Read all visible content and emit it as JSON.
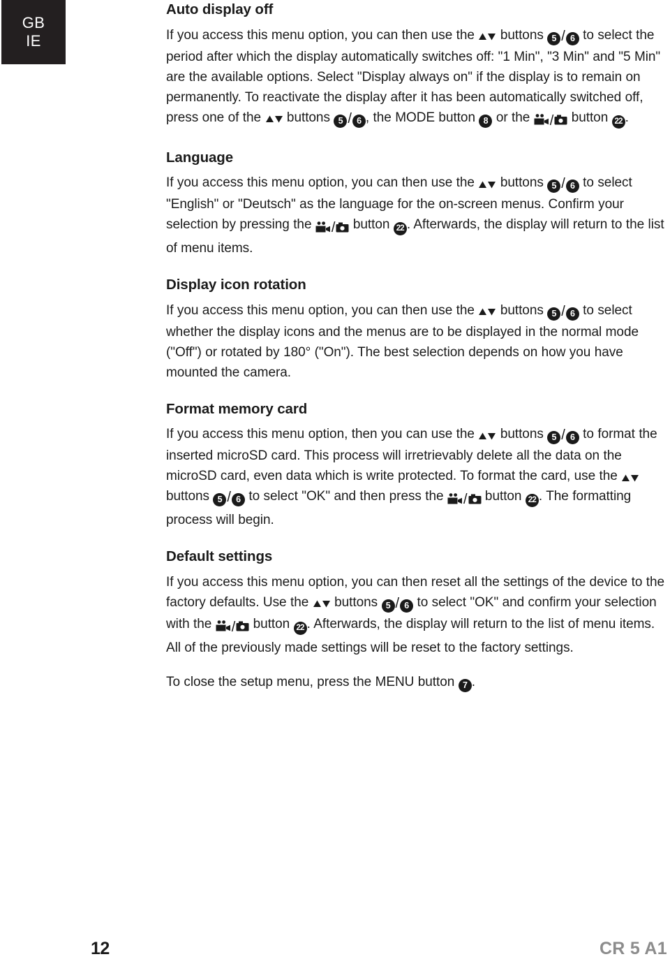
{
  "page": {
    "country_badge": {
      "line1": "GB",
      "line2": "IE"
    },
    "footer": {
      "page_number": "12",
      "document_code": "CR 5 A1"
    },
    "colors": {
      "badge_background": "#231f20",
      "badge_text": "#ffffff",
      "body_text": "#1a1a1a",
      "doc_code_gray": "#8c8c8c",
      "icon_black": "#1a1a1a"
    }
  },
  "sections": [
    {
      "id": "auto-display-off",
      "heading": "Auto display off",
      "paragraphs": [
        {
          "runs": [
            {
              "type": "text",
              "value": "If you access this menu option, you can then use the "
            },
            {
              "type": "arrows",
              "value": "▲▼"
            },
            {
              "type": "text",
              "value": " buttons "
            },
            {
              "type": "badge",
              "value": "5"
            },
            {
              "type": "slash",
              "value": "/"
            },
            {
              "type": "badge",
              "value": "6"
            },
            {
              "type": "text",
              "value": " to select the period after which the display automatically switches off: \"1 Min\", \"3 Min\" and \"5 Min\" are the available options. Select \"Display always on\" if the display is to remain on permanently. To reactivate the display after it has been automatically switched off, press one of the "
            },
            {
              "type": "arrows",
              "value": "▲▼"
            },
            {
              "type": "text",
              "value": " buttons "
            },
            {
              "type": "badge",
              "value": "5"
            },
            {
              "type": "slash",
              "value": "/"
            },
            {
              "type": "badge",
              "value": "6"
            },
            {
              "type": "text",
              "value": ", the MODE button "
            },
            {
              "type": "badge",
              "value": "8"
            },
            {
              "type": "text",
              "value": " or the "
            },
            {
              "type": "camera-pair",
              "value": "video/photo"
            },
            {
              "type": "text",
              "value": " button "
            },
            {
              "type": "badge",
              "value": "22"
            },
            {
              "type": "text",
              "value": "."
            }
          ]
        }
      ]
    },
    {
      "id": "language",
      "heading": "Language",
      "paragraphs": [
        {
          "runs": [
            {
              "type": "text",
              "value": "If you access this menu option, you can then use the "
            },
            {
              "type": "arrows",
              "value": "▲▼"
            },
            {
              "type": "text",
              "value": " buttons "
            },
            {
              "type": "badge",
              "value": "5"
            },
            {
              "type": "slash",
              "value": "/"
            },
            {
              "type": "badge",
              "value": "6"
            },
            {
              "type": "text",
              "value": " to select \"English\" or \"Deutsch\" as the language for the on-screen menus. Confirm your selection by pressing the "
            },
            {
              "type": "camera-pair",
              "value": "video/photo"
            },
            {
              "type": "text",
              "value": " button "
            },
            {
              "type": "badge",
              "value": "22"
            },
            {
              "type": "text",
              "value": ". Afterwards, the display will return to the list of menu items."
            }
          ]
        }
      ]
    },
    {
      "id": "display-icon-rotation",
      "heading": "Display icon rotation",
      "paragraphs": [
        {
          "runs": [
            {
              "type": "text",
              "value": "If you access this menu option, you can then use the "
            },
            {
              "type": "arrows",
              "value": "▲▼"
            },
            {
              "type": "text",
              "value": " buttons "
            },
            {
              "type": "badge",
              "value": "5"
            },
            {
              "type": "slash",
              "value": "/"
            },
            {
              "type": "badge",
              "value": "6"
            },
            {
              "type": "text",
              "value": " to select whether the display icons and the menus are to be displayed in the normal mode (\"Off\") or rotated by 180° (\"On\"). The best selection depends on how you have mounted the camera."
            }
          ]
        }
      ]
    },
    {
      "id": "format-memory-card",
      "heading": "Format memory card",
      "paragraphs": [
        {
          "runs": [
            {
              "type": "text",
              "value": "If you access this menu option, then you can use the "
            },
            {
              "type": "arrows",
              "value": "▲▼"
            },
            {
              "type": "text",
              "value": " buttons "
            },
            {
              "type": "badge",
              "value": "5"
            },
            {
              "type": "slash",
              "value": "/"
            },
            {
              "type": "badge",
              "value": "6"
            },
            {
              "type": "text",
              "value": " to format the inserted microSD card. This process will irretrievably delete all the data on the microSD card, even data which is write protected. To format the card, use the "
            },
            {
              "type": "arrows",
              "value": "▲▼"
            },
            {
              "type": "text",
              "value": " buttons "
            },
            {
              "type": "badge",
              "value": "5"
            },
            {
              "type": "slash",
              "value": "/"
            },
            {
              "type": "badge",
              "value": "6"
            },
            {
              "type": "text",
              "value": " to select \"OK\" and then press the "
            },
            {
              "type": "camera-pair",
              "value": "video/photo"
            },
            {
              "type": "text",
              "value": " button "
            },
            {
              "type": "badge",
              "value": "22"
            },
            {
              "type": "text",
              "value": ". The formatting process will begin."
            }
          ]
        }
      ]
    },
    {
      "id": "default-settings",
      "heading": "Default settings",
      "paragraphs": [
        {
          "runs": [
            {
              "type": "text",
              "value": "If you access this menu option, you can then reset all the settings of the device to the factory defaults. Use the "
            },
            {
              "type": "arrows",
              "value": "▲▼"
            },
            {
              "type": "text",
              "value": " buttons "
            },
            {
              "type": "badge",
              "value": "5"
            },
            {
              "type": "slash",
              "value": "/"
            },
            {
              "type": "badge",
              "value": "6"
            },
            {
              "type": "text",
              "value": " to select \"OK\" and confirm your selection with the "
            },
            {
              "type": "camera-pair",
              "value": "video/photo"
            },
            {
              "type": "text",
              "value": " button "
            },
            {
              "type": "badge",
              "value": "22"
            },
            {
              "type": "text",
              "value": ". Afterwards, the display will return to the list of menu items. All of the previously made settings will be reset to the factory settings."
            }
          ]
        },
        {
          "closing": true,
          "runs": [
            {
              "type": "text",
              "value": "To close the setup menu, press the MENU button "
            },
            {
              "type": "badge",
              "value": "7"
            },
            {
              "type": "text",
              "value": "."
            }
          ]
        }
      ]
    }
  ]
}
